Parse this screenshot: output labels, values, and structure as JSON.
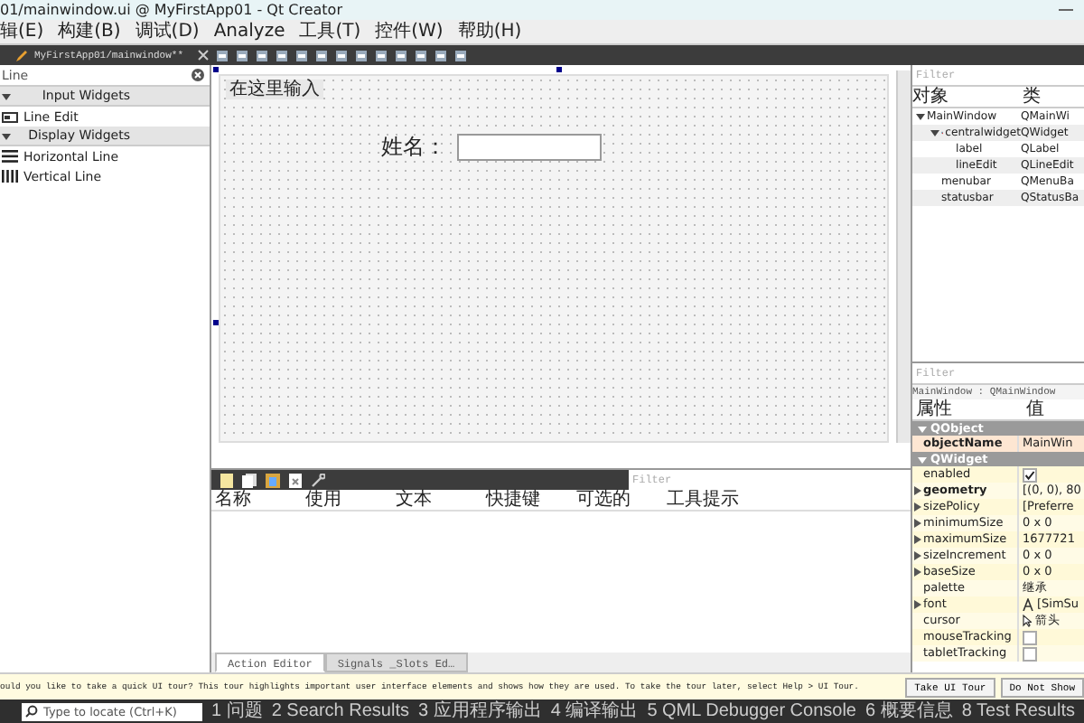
{
  "window": {
    "title": "01/mainwindow.ui @ MyFirstApp01 - Qt Creator"
  },
  "menu": [
    "辑(E)",
    "构建(B)",
    "调试(D)",
    "Analyze",
    "工具(T)",
    "控件(W)",
    "帮助(H)"
  ],
  "toolbar": {
    "document": "MyFirstApp01/mainwindow**"
  },
  "widget_box": {
    "search": "Line",
    "categories": [
      {
        "name": "Input Widgets",
        "expanded": true,
        "items": [
          {
            "label": "Line Edit",
            "kind": "lineedit"
          }
        ]
      },
      {
        "name": "Display Widgets",
        "expanded": true,
        "items": [
          {
            "label": "Horizontal Line",
            "kind": "hline"
          },
          {
            "label": "Vertical Line",
            "kind": "vline"
          }
        ]
      }
    ]
  },
  "form": {
    "menu_placeholder": "在这里输入",
    "label": "姓名："
  },
  "object_inspector": {
    "filter_placeholder": "Filter",
    "columns": [
      "对象",
      "类"
    ],
    "tree": [
      {
        "name": "MainWindow",
        "class": "QMainWi",
        "expanded": true,
        "children": [
          {
            "name": "centralwidget",
            "class": "QWidget",
            "expanded": true,
            "children": [
              {
                "name": "label",
                "class": "QLabel"
              },
              {
                "name": "lineEdit",
                "class": "QLineEdit"
              }
            ]
          },
          {
            "name": "menubar",
            "class": "QMenuBa"
          },
          {
            "name": "statusbar",
            "class": "QStatusBa"
          }
        ]
      }
    ]
  },
  "property_editor": {
    "filter_placeholder": "Filter",
    "context": "MainWindow : QMainWindow",
    "columns": [
      "属性",
      "值"
    ],
    "rows": [
      {
        "kind": "section",
        "name": "QObject"
      },
      {
        "kind": "text",
        "name": "objectName",
        "value": "MainWin",
        "modified": true,
        "expandable": false
      },
      {
        "kind": "section",
        "name": "QWidget"
      },
      {
        "kind": "check",
        "name": "enabled",
        "checked": true,
        "modified": false,
        "expandable": false
      },
      {
        "kind": "text",
        "name": "geometry",
        "value": "[(0, 0), 80",
        "modified": true,
        "expandable": true
      },
      {
        "kind": "text",
        "name": "sizePolicy",
        "value": "[Preferre",
        "modified": false,
        "expandable": true
      },
      {
        "kind": "text",
        "name": "minimumSize",
        "value": "0 x 0",
        "modified": false,
        "expandable": true
      },
      {
        "kind": "text",
        "name": "maximumSize",
        "value": "1677721",
        "modified": false,
        "expandable": true
      },
      {
        "kind": "text",
        "name": "sizeIncrement",
        "value": "0 x 0",
        "modified": false,
        "expandable": true
      },
      {
        "kind": "text",
        "name": "baseSize",
        "value": "0 x 0",
        "modified": false,
        "expandable": true
      },
      {
        "kind": "text",
        "name": "palette",
        "value": "继承",
        "modified": false,
        "expandable": false
      },
      {
        "kind": "font",
        "name": "font",
        "value": "[SimSu",
        "modified": false,
        "expandable": true
      },
      {
        "kind": "cursor",
        "name": "cursor",
        "value": "箭头",
        "modified": false,
        "expandable": false
      },
      {
        "kind": "check",
        "name": "mouseTracking",
        "checked": false,
        "modified": false,
        "expandable": false
      },
      {
        "kind": "check",
        "name": "tabletTracking",
        "checked": false,
        "modified": false,
        "expandable": false
      }
    ]
  },
  "action_editor": {
    "filter_placeholder": "Filter",
    "columns": [
      "名称",
      "使用",
      "文本",
      "快捷键",
      "可选的",
      "工具提示"
    ],
    "tabs": [
      {
        "label": "Action Editor",
        "selected": true
      },
      {
        "label": "Signals _Slots Ed…",
        "selected": false
      }
    ]
  },
  "tour": {
    "message": "ould you like to take a quick UI tour? This tour highlights important user interface elements and shows how they are used. To take the tour later, select Help > UI Tour.",
    "buttons": [
      "Take UI Tour",
      "Do Not Show"
    ]
  },
  "status_bar": {
    "locator_placeholder": "Type to locate (Ctrl+K)",
    "panes": [
      "1 问题",
      "2 Search Results",
      "3 应用程序输出",
      "4 编译输出",
      "5 QML Debugger Console",
      "6 概要信息",
      "8 Test Results"
    ]
  }
}
